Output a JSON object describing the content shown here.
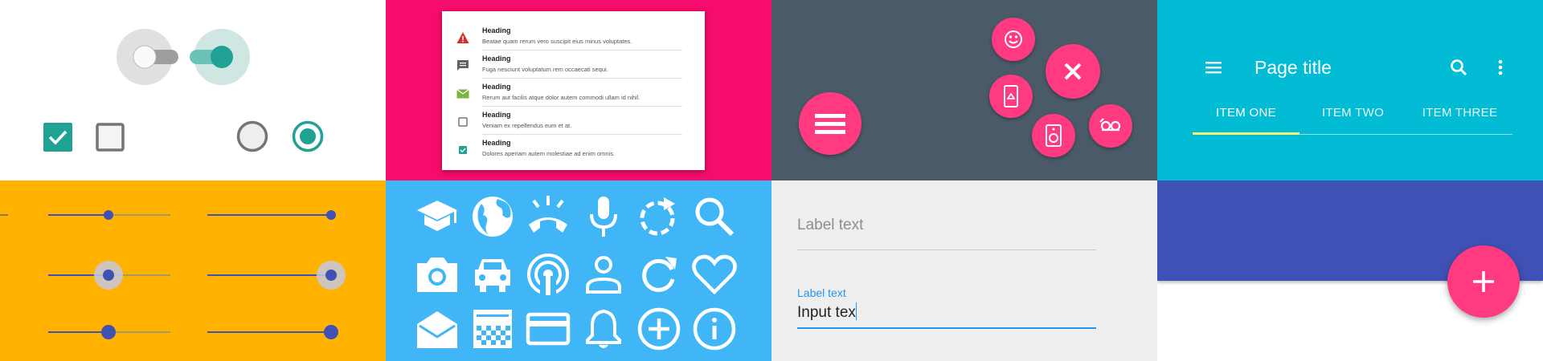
{
  "colors": {
    "teal": "#1fa294",
    "pink_bg": "#f50c6c",
    "slate_bg": "#4a5a68",
    "cyan_bg": "#02bcd5",
    "amber_bg": "#ffb300",
    "lightblue_bg": "#40b6f6",
    "gray_bg": "#eeeeee",
    "indigo_bg": "#3f51b5",
    "fab_pink": "#ff3a80",
    "slider_indigo": "#3f51b5",
    "input_blue": "#2196f3"
  },
  "list": {
    "items": [
      {
        "icon": "warning-icon",
        "heading": "Heading",
        "text": "Beatae quam rerum vero suscipit eius minus voluptates."
      },
      {
        "icon": "comment-icon",
        "heading": "Heading",
        "text": "Fuga nesciunt voluptatum rem occaecati sequi."
      },
      {
        "icon": "mail-icon",
        "heading": "Heading",
        "text": "Rerum aut facilis atque dolor autem commodi ullam id nihil."
      },
      {
        "icon": "checkbox-empty-icon",
        "heading": "Heading",
        "text": "Veniam ex repellendus eum et at."
      },
      {
        "icon": "checkbox-checked-icon",
        "heading": "Heading",
        "text": "Dolores aperiam autem molestiae ad enim omnis."
      }
    ]
  },
  "appbar": {
    "title": "Page title",
    "tabs": [
      "ITEM ONE",
      "ITEM TWO",
      "ITEM THREE"
    ],
    "selected_tab": "ITEM ONE"
  },
  "sliders": {
    "values": [
      0.5,
      1.0,
      0.5,
      1.0,
      0.5,
      1.0
    ]
  },
  "icons": [
    "graduation-cap-icon",
    "globe-icon",
    "phone-ringing-icon",
    "microphone-icon",
    "refresh-dashed-icon",
    "search-icon",
    "camera-icon",
    "car-icon",
    "wireless-icon",
    "person-icon",
    "refresh-icon",
    "heart-icon",
    "drafts-icon",
    "checkerboard-icon",
    "credit-card-icon",
    "bell-icon",
    "add-circle-icon",
    "info-icon"
  ],
  "textfield": {
    "placeholder_label": "Label text",
    "active_label": "Label text",
    "active_value": "Input tex"
  }
}
